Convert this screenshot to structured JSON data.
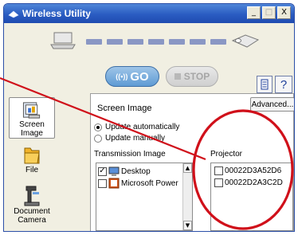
{
  "window": {
    "title": "Wireless Utility"
  },
  "titlebar_buttons": [
    "_",
    "□",
    "X"
  ],
  "icons": {
    "app": "wireless-utility-icon",
    "laptop": "laptop-icon",
    "projector": "projector-icon",
    "list": "list-icon",
    "help": "help-icon"
  },
  "toolbar": {
    "go_label": "GO",
    "go_icon": "((•))",
    "stop_label": "STOP",
    "help_label": "?"
  },
  "sidebar": {
    "items": [
      {
        "label": "Screen Image",
        "icon": "screen-image-icon",
        "active": true
      },
      {
        "label": "File",
        "icon": "file-icon",
        "active": false
      },
      {
        "label": "Document Camera",
        "label_line1": "Document",
        "label_line2": "Camera",
        "icon": "document-camera-icon",
        "active": false
      }
    ]
  },
  "panel": {
    "title": "Screen Image",
    "advanced_button": "Advanced...",
    "update_options": [
      {
        "label": "Update automatically",
        "selected": true
      },
      {
        "label": "Update manually",
        "selected": false
      }
    ],
    "transmission_label": "Transmission Image",
    "transmission_items": [
      {
        "label": "Desktop",
        "checked": true,
        "icon": "desktop-icon"
      },
      {
        "label": "Microsoft Power",
        "checked": false,
        "icon": "powerpoint-icon"
      }
    ],
    "projector_label": "Projector",
    "projectors": [
      {
        "label": "00022D3A52D6",
        "checked": false
      },
      {
        "label": "00022D2A3C2D",
        "checked": false
      }
    ]
  },
  "colors": {
    "titlebar": "#2a5cc2",
    "annotation": "#d0101a",
    "go_button": "#5e9bd4"
  }
}
